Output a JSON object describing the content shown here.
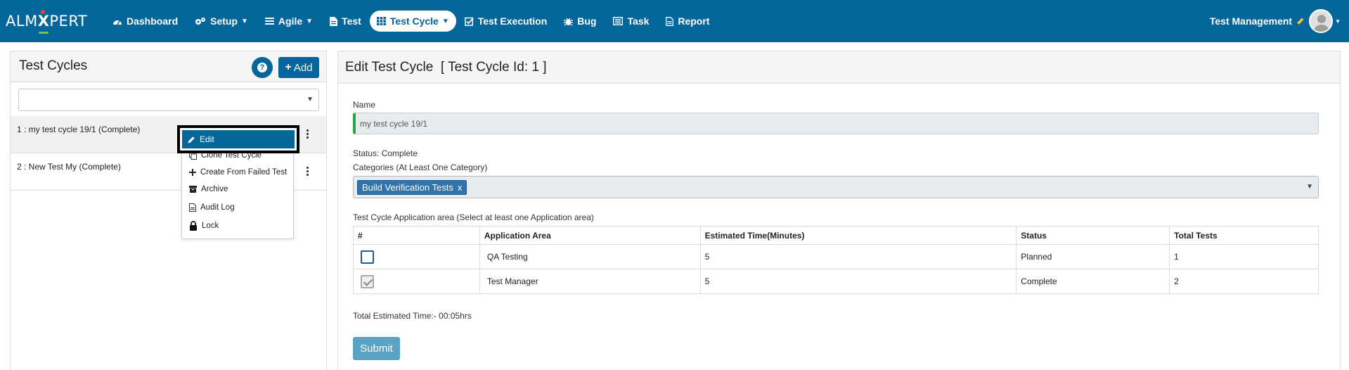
{
  "brand": {
    "logo_left": "ALM",
    "logo_x": "X",
    "logo_right": "PERT"
  },
  "nav": {
    "items": [
      {
        "label": "Dashboard",
        "icon": "dashboard-icon",
        "caret": false
      },
      {
        "label": "Setup",
        "icon": "gears-icon",
        "caret": true
      },
      {
        "label": "Agile",
        "icon": "list-icon",
        "caret": true
      },
      {
        "label": "Test",
        "icon": "document-icon",
        "caret": false
      },
      {
        "label": "Test Cycle",
        "icon": "grid-icon",
        "caret": true,
        "active": true
      },
      {
        "label": "Test Execution",
        "icon": "check-square-icon",
        "caret": false
      },
      {
        "label": "Bug",
        "icon": "bug-icon",
        "caret": false
      },
      {
        "label": "Task",
        "icon": "tasks-icon",
        "caret": false
      },
      {
        "label": "Report",
        "icon": "report-icon",
        "caret": false
      }
    ],
    "user_label": "Test Management"
  },
  "left": {
    "title": "Test Cycles",
    "help_label": "?",
    "add_label": "Add",
    "filter_value": "",
    "cycles": [
      {
        "label": "1 : my test cycle 19/1 (Complete)"
      },
      {
        "label": "2 : New Test My (Complete)"
      }
    ],
    "menu": {
      "edit": "Edit",
      "items": [
        {
          "label": "Clone Test Cycle",
          "icon": "copy-icon"
        },
        {
          "label": "Create From Failed Test",
          "icon": "plus-icon"
        },
        {
          "label": "Archive",
          "icon": "archive-icon"
        },
        {
          "label": "Audit Log",
          "icon": "file-icon"
        },
        {
          "label": "Lock",
          "icon": "lock-icon"
        }
      ]
    }
  },
  "right": {
    "title": "Edit Test Cycle  [ Test Cycle Id: 1 ]",
    "name_label": "Name",
    "name_value": "my test cycle 19/1",
    "status_text": "Status: Complete",
    "categories_label": "Categories (At Least One Category)",
    "category_chip": "Build Verification Tests",
    "chip_remove": "x",
    "areas_label": "Test Cycle Application area (Select at least one Application area)",
    "table": {
      "headers": [
        "#",
        "Application Area",
        "Estimated Time(Minutes)",
        "Status",
        "Total Tests"
      ],
      "rows": [
        {
          "checked": false,
          "area": "QA Testing",
          "time": "5",
          "status": "Planned",
          "total": "1"
        },
        {
          "checked": true,
          "area": "Test Manager",
          "time": "5",
          "status": "Complete",
          "total": "2"
        }
      ]
    },
    "total_time": "Total Estimated Time:- 00:05hrs",
    "submit_label": "Submit"
  },
  "colors": {
    "brand": "#04669a",
    "success_border": "#28a745",
    "chip": "#3174ad",
    "submit": "#5aa3c6"
  }
}
